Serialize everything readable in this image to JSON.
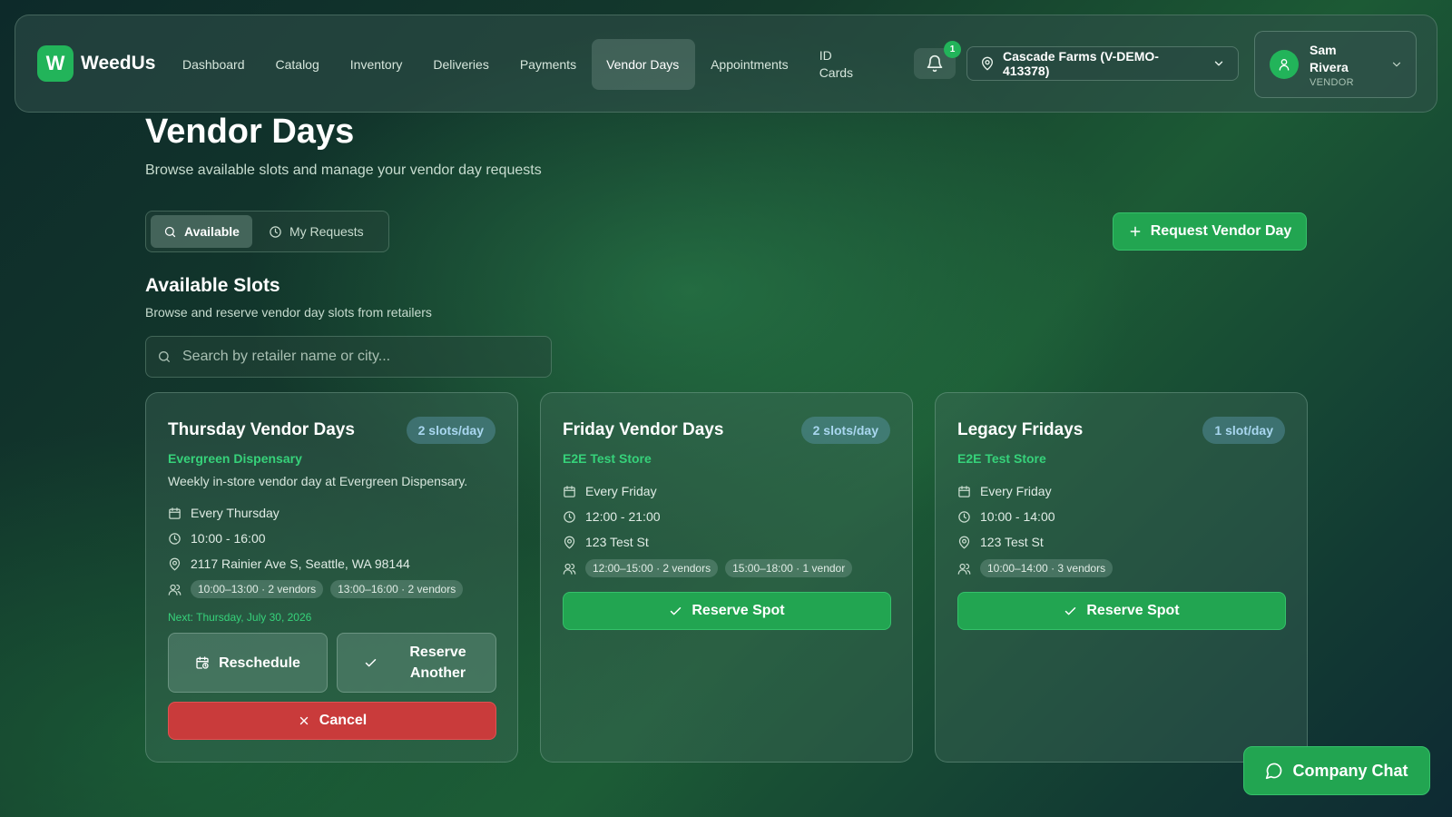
{
  "brand": {
    "logo_letter": "W",
    "name": "WeedUs"
  },
  "nav": {
    "items": [
      {
        "label": "Dashboard"
      },
      {
        "label": "Catalog"
      },
      {
        "label": "Inventory"
      },
      {
        "label": "Deliveries"
      },
      {
        "label": "Payments"
      },
      {
        "label": "Vendor Days",
        "active": true
      },
      {
        "label": "Appointments"
      },
      {
        "label": "ID Cards"
      }
    ]
  },
  "notifications": {
    "count": "1",
    "icon": "bell-icon"
  },
  "store_selector": {
    "value": "Cascade Farms (V-DEMO-413378)",
    "icon": "map-pin-icon"
  },
  "user": {
    "name": "Sam Rivera",
    "role": "VENDOR"
  },
  "page": {
    "title": "Vendor Days",
    "subtitle": "Browse available slots and manage your vendor day requests"
  },
  "tabs": [
    {
      "label": "Available",
      "icon": "search-icon",
      "active": true
    },
    {
      "label": "My Requests",
      "icon": "clock-icon",
      "active": false
    }
  ],
  "request_button": {
    "label": "Request Vendor Day"
  },
  "section": {
    "title": "Available Slots",
    "subtitle": "Browse and reserve vendor day slots from retailers"
  },
  "search": {
    "placeholder": "Search by retailer name or city...",
    "value": ""
  },
  "cards": [
    {
      "title": "Thursday Vendor Days",
      "badge": "2 slots/day",
      "store": "Evergreen Dispensary",
      "description": "Weekly in-store vendor day at Evergreen Dispensary.",
      "schedule": "Every Thursday",
      "hours": "10:00 - 16:00",
      "address": "2117 Rainier Ave S, Seattle, WA 98144",
      "slots": [
        "10:00–13:00 · 2 vendors",
        "13:00–16:00 · 2 vendors"
      ],
      "next": "Next: Thursday, July 30, 2026",
      "actions": {
        "reschedule": "Reschedule",
        "reserve_another": "Reserve Another",
        "cancel": "Cancel"
      }
    },
    {
      "title": "Friday Vendor Days",
      "badge": "2 slots/day",
      "store": "E2E Test Store",
      "schedule": "Every Friday",
      "hours": "12:00 - 21:00",
      "address": "123 Test St",
      "slots": [
        "12:00–15:00 · 2 vendors",
        "15:00–18:00 · 1 vendor"
      ],
      "actions": {
        "reserve": "Reserve Spot"
      }
    },
    {
      "title": "Legacy Fridays",
      "badge": "1 slot/day",
      "store": "E2E Test Store",
      "schedule": "Every Friday",
      "hours": "10:00 - 14:00",
      "address": "123 Test St",
      "slots": [
        "10:00–14:00 · 3 vendors"
      ],
      "actions": {
        "reserve": "Reserve Spot"
      }
    }
  ],
  "chat_button": {
    "label": "Company Chat"
  },
  "colors": {
    "accent": "#22a551",
    "accent_text": "#36d27a",
    "danger": "#c93b3b",
    "badge_text": "#a9d7f0"
  }
}
